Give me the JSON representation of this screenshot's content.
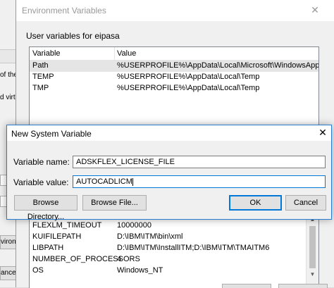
{
  "background_window": {
    "fragments": [
      "of the",
      "d virtu"
    ],
    "buttons": [
      "vironm",
      "ancel"
    ]
  },
  "env_dialog": {
    "title": "Environment Variables",
    "close_glyph": "✕",
    "user_vars_label": "User variables for eipasa",
    "user_vars": {
      "headers": [
        "Variable",
        "Value"
      ],
      "rows": [
        {
          "name": "Path",
          "value": "%USERPROFILE%\\AppData\\Local\\Microsoft\\WindowsApps;"
        },
        {
          "name": "TEMP",
          "value": "%USERPROFILE%\\AppData\\Local\\Temp"
        },
        {
          "name": "TMP",
          "value": "%USERPROFILE%\\AppData\\Local\\Temp"
        }
      ]
    },
    "system_vars": {
      "rows": [
        {
          "name": "FLEXLM_TIMEOUT",
          "value": "10000000"
        },
        {
          "name": "KUIFILEPATH",
          "value": "D:\\IBM\\ITM\\bin\\xml"
        },
        {
          "name": "LIBPATH",
          "value": "D:\\IBM\\ITM\\InstallITM;D:\\IBM\\ITM\\TMAITM6"
        },
        {
          "name": "NUMBER_OF_PROCESSORS",
          "value": "4"
        },
        {
          "name": "OS",
          "value": "Windows_NT"
        }
      ]
    }
  },
  "new_var_dialog": {
    "title": "New System Variable",
    "close_glyph": "✕",
    "name_label": "Variable name:",
    "name_value": "ADSKFLEX_LICENSE_FILE",
    "value_label": "Variable value:",
    "value_value": "AUTOCADLICM",
    "buttons": {
      "browse_directory": "Browse Directory...",
      "browse_file": "Browse File...",
      "ok": "OK",
      "cancel": "Cancel"
    }
  }
}
